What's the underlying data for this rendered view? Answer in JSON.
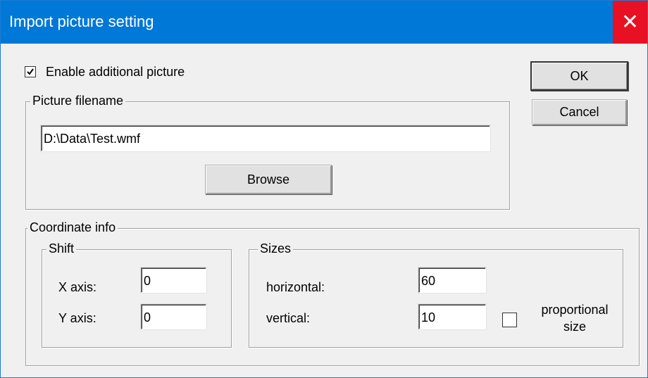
{
  "window": {
    "title": "Import picture setting",
    "close_glyph": "✕"
  },
  "enable_additional_picture": {
    "label": "Enable additional picture",
    "checked": true
  },
  "buttons": {
    "ok": "OK",
    "cancel": "Cancel",
    "browse": "Browse"
  },
  "picture_filename": {
    "group_label": "Picture filename",
    "value": "D:\\Data\\Test.wmf"
  },
  "coordinate_info": {
    "group_label": "Coordinate info",
    "shift": {
      "group_label": "Shift",
      "x_axis_label": "X axis:",
      "x_axis_value": "0",
      "y_axis_label": "Y axis:",
      "y_axis_value": "0"
    },
    "sizes": {
      "group_label": "Sizes",
      "horizontal_label": "horizontal:",
      "horizontal_value": "60",
      "vertical_label": "vertical:",
      "vertical_value": "10",
      "proportional_label_line1": "proportional",
      "proportional_label_line2": "size",
      "proportional_checked": false
    }
  },
  "colors": {
    "titlebar": "#0078d7",
    "close": "#e81123",
    "dialog_bg": "#f0f0f0"
  }
}
